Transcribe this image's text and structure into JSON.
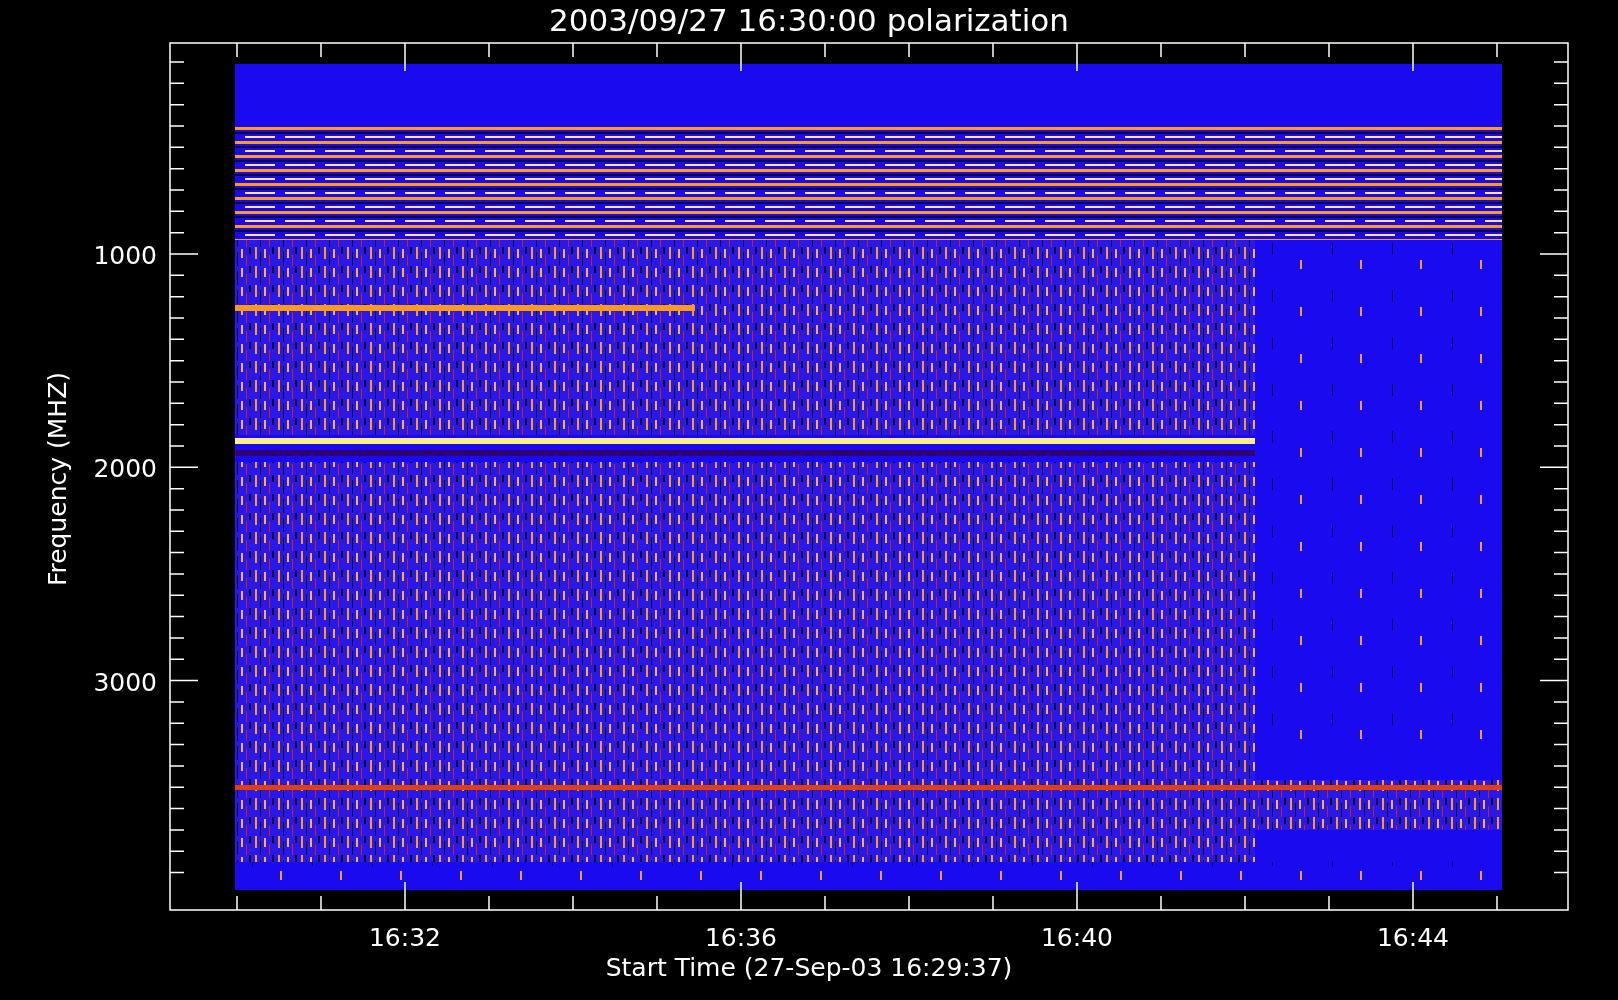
{
  "chart": {
    "title": "2003/09/27 16:30:00 polarization",
    "ylabel": "Frequency (MHZ)",
    "xlabel": "Start Time (27-Sep-03 16:29:37)",
    "yticks": [
      "1000",
      "2000",
      "3000"
    ],
    "xticks": [
      "16:32",
      "16:36",
      "16:40",
      "16:44"
    ]
  }
}
